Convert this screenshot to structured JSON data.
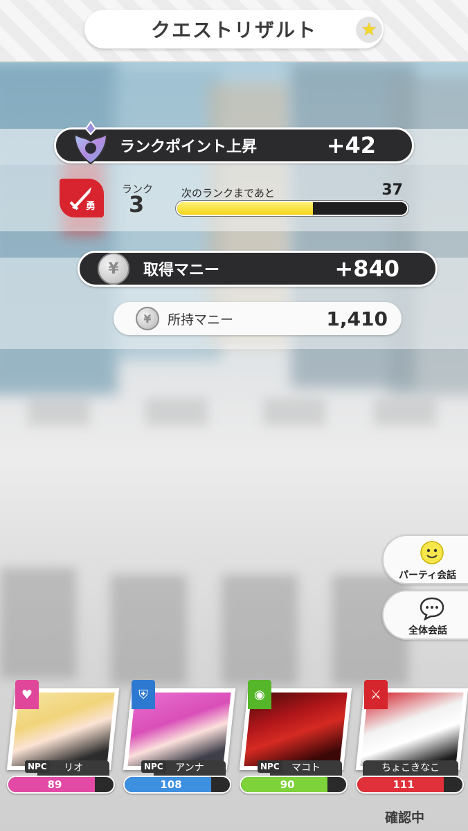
{
  "header": {
    "title": "クエストリザルト",
    "left_icon": "star-icon",
    "right_icon": "star-icon"
  },
  "rank_point": {
    "label": "ランクポイント上昇",
    "value": "+42",
    "emblem_icon": "rank-emblem-icon"
  },
  "rank": {
    "label": "ランク",
    "number": "3",
    "badge_icon": "sword-icon",
    "badge_text": "勇",
    "next_label": "次のランクまであと",
    "next_value": "37",
    "progress": 0.59,
    "bar_color": "#f3d51b"
  },
  "money": {
    "gained_label": "取得マニー",
    "gained_value": "+840",
    "owned_label": "所持マニー",
    "owned_value": "1,410",
    "coin_icon": "coin-icon"
  },
  "side_buttons": [
    {
      "label": "パーティ会話",
      "icon": "smiley-icon"
    },
    {
      "label": "全体会話",
      "icon": "speech-bubble-icon"
    }
  ],
  "party": [
    {
      "name": "リオ",
      "npc": "NPC",
      "hp": "89",
      "hp_fraction": 0.82,
      "role_icon": "heart-icon",
      "tag_color": "#e0479b",
      "hp_color": "#e24aa6"
    },
    {
      "name": "アンナ",
      "npc": "NPC",
      "hp": "108",
      "hp_fraction": 0.82,
      "role_icon": "shield-icon",
      "tag_color": "#2d79d1",
      "hp_color": "#3d8fe0"
    },
    {
      "name": "マコト",
      "npc": "NPC",
      "hp": "90",
      "hp_fraction": 0.82,
      "role_icon": "eye-icon",
      "tag_color": "#55b62a",
      "hp_color": "#7ed23a"
    },
    {
      "name": "ちょこきなこ",
      "npc": "",
      "hp": "111",
      "hp_fraction": 0.82,
      "role_icon": "sword-icon",
      "tag_color": "#d5262e",
      "hp_color": "#e03039"
    }
  ],
  "status_text": "確認中"
}
